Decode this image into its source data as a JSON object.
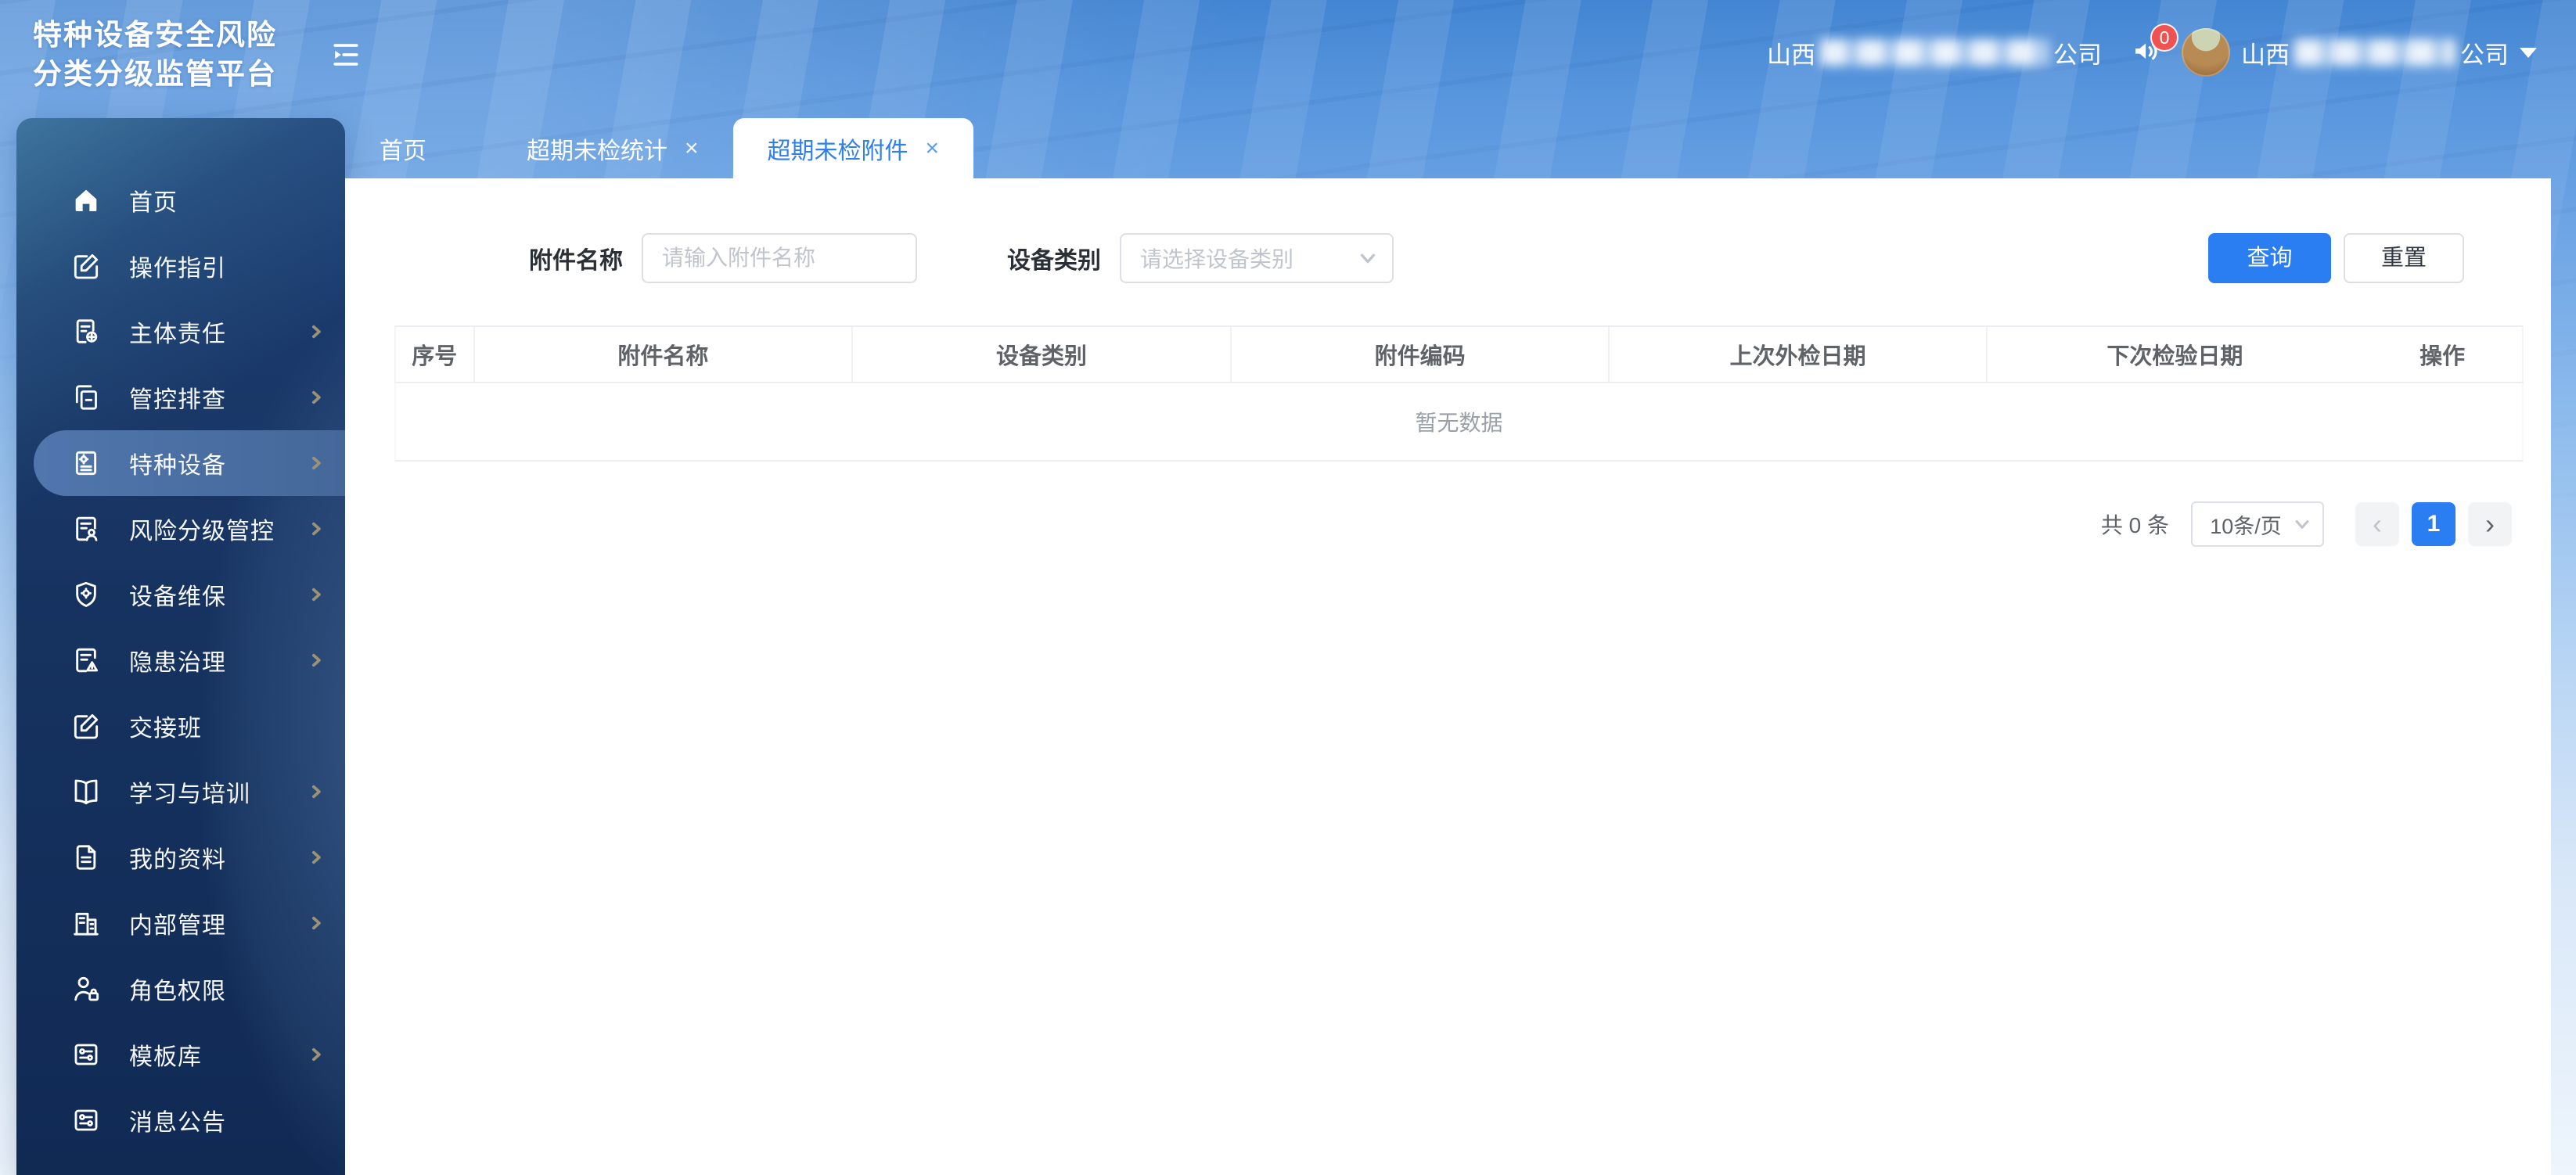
{
  "app": {
    "title_line1": "特种设备安全风险",
    "title_line2": "分类分级监管平台"
  },
  "header": {
    "company_prefix": "山西",
    "company_suffix": "公司",
    "notification_count": "0",
    "user_prefix": "山西",
    "user_suffix": "公司",
    "icons": {
      "collapse": "indent-collapse-icon",
      "notification": "speaker-icon",
      "user_caret": "caret-down-icon"
    }
  },
  "sidebar": {
    "items": [
      {
        "label": "首页",
        "icon": "home-icon",
        "has_children": false,
        "active": false
      },
      {
        "label": "操作指引",
        "icon": "edit-icon",
        "has_children": false,
        "active": false
      },
      {
        "label": "主体责任",
        "icon": "document-seal-icon",
        "has_children": true,
        "active": false
      },
      {
        "label": "管控排查",
        "icon": "copy-docs-icon",
        "has_children": true,
        "active": false
      },
      {
        "label": "特种设备",
        "icon": "document-gear-icon",
        "has_children": true,
        "active": true
      },
      {
        "label": "风险分级管控",
        "icon": "document-person-icon",
        "has_children": true,
        "active": false
      },
      {
        "label": "设备维保",
        "icon": "shield-gear-icon",
        "has_children": true,
        "active": false
      },
      {
        "label": "隐患治理",
        "icon": "document-warning-icon",
        "has_children": true,
        "active": false
      },
      {
        "label": "交接班",
        "icon": "edit-icon",
        "has_children": false,
        "active": false
      },
      {
        "label": "学习与培训",
        "icon": "open-book-icon",
        "has_children": true,
        "active": false
      },
      {
        "label": "我的资料",
        "icon": "file-text-icon",
        "has_children": true,
        "active": false
      },
      {
        "label": "内部管理",
        "icon": "building-icon",
        "has_children": true,
        "active": false
      },
      {
        "label": "角色权限",
        "icon": "person-lock-icon",
        "has_children": false,
        "active": false
      },
      {
        "label": "模板库",
        "icon": "sliders-card-icon",
        "has_children": true,
        "active": false
      },
      {
        "label": "消息公告",
        "icon": "sliders-card-icon",
        "has_children": false,
        "active": false
      }
    ]
  },
  "tabs": [
    {
      "label": "首页",
      "closable": false,
      "active": false
    },
    {
      "label": "超期未检统计",
      "closable": true,
      "active": false
    },
    {
      "label": "超期未检附件",
      "closable": true,
      "active": true
    }
  ],
  "ui": {
    "close_glyph": "×"
  },
  "filters": {
    "name_label": "附件名称",
    "name_placeholder": "请输入附件名称",
    "type_label": "设备类别",
    "type_placeholder": "请选择设备类别",
    "search_label": "查询",
    "reset_label": "重置"
  },
  "table": {
    "columns": [
      "序号",
      "附件名称",
      "设备类别",
      "附件编码",
      "上次外检日期",
      "下次检验日期",
      "操作"
    ],
    "empty_text": "暂无数据"
  },
  "pagination": {
    "total_text": "共 0 条",
    "page_size": "10条/页",
    "current_page": "1",
    "prev_glyph": "‹",
    "next_glyph": "›"
  },
  "colors": {
    "primary": "#2b7df2",
    "sidebar_bg": "#16325f",
    "sidebar_active": "#4c72a9",
    "badge_red": "#f05252",
    "header_text": "#ffffff",
    "table_border": "#eceef3",
    "placeholder": "#c0c4cc"
  }
}
